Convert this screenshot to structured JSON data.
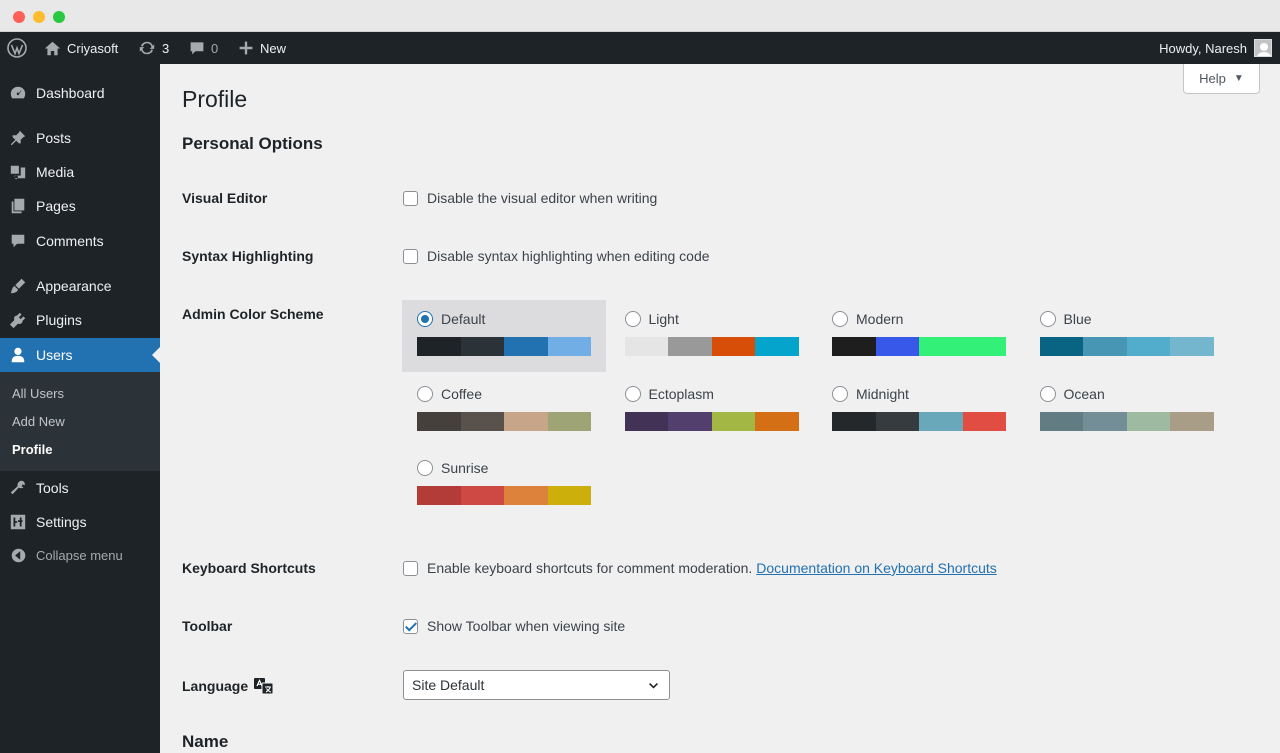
{
  "adminbar": {
    "site_name": "Criyasoft",
    "updates_count": "3",
    "comments_count": "0",
    "new_label": "New",
    "howdy": "Howdy, Naresh"
  },
  "sidebar": {
    "items": [
      {
        "label": "Dashboard",
        "icon": "dashboard-icon"
      },
      {
        "label": "Posts",
        "icon": "pin-icon"
      },
      {
        "label": "Media",
        "icon": "media-icon"
      },
      {
        "label": "Pages",
        "icon": "pages-icon"
      },
      {
        "label": "Comments",
        "icon": "comment-icon"
      },
      {
        "label": "Appearance",
        "icon": "brush-icon"
      },
      {
        "label": "Plugins",
        "icon": "plugin-icon"
      },
      {
        "label": "Users",
        "icon": "user-icon"
      },
      {
        "label": "Tools",
        "icon": "wrench-icon"
      },
      {
        "label": "Settings",
        "icon": "settings-icon"
      }
    ],
    "submenu": [
      "All Users",
      "Add New",
      "Profile"
    ],
    "collapse_label": "Collapse menu"
  },
  "help_label": "Help",
  "page_title": "Profile",
  "personal_options_title": "Personal Options",
  "visual_editor": {
    "label": "Visual Editor",
    "text": "Disable the visual editor when writing",
    "checked": false
  },
  "syntax": {
    "label": "Syntax Highlighting",
    "text": "Disable syntax highlighting when editing code",
    "checked": false
  },
  "color_scheme": {
    "label": "Admin Color Scheme",
    "selected": "Default",
    "schemes": [
      {
        "name": "Default",
        "colors": [
          "#1d2327",
          "#2c3338",
          "#2271b1",
          "#72aee6"
        ]
      },
      {
        "name": "Light",
        "colors": [
          "#e5e5e5",
          "#999999",
          "#d64e07",
          "#04a4cc"
        ]
      },
      {
        "name": "Modern",
        "colors": [
          "#1e1e1e",
          "#3858e9",
          "#33f078",
          "#33f078"
        ]
      },
      {
        "name": "Blue",
        "colors": [
          "#096484",
          "#4796b3",
          "#52accc",
          "#74b6ce"
        ]
      },
      {
        "name": "Coffee",
        "colors": [
          "#46403c",
          "#59524c",
          "#c7a589",
          "#9ea476"
        ]
      },
      {
        "name": "Ectoplasm",
        "colors": [
          "#413256",
          "#523f6d",
          "#a3b745",
          "#d46f15"
        ]
      },
      {
        "name": "Midnight",
        "colors": [
          "#25282b",
          "#363b3f",
          "#69a8bb",
          "#e14d43"
        ]
      },
      {
        "name": "Ocean",
        "colors": [
          "#627c83",
          "#738e96",
          "#9ebaa0",
          "#aa9d88"
        ]
      },
      {
        "name": "Sunrise",
        "colors": [
          "#b43c38",
          "#cf4944",
          "#dd823b",
          "#ccaf0b"
        ]
      }
    ]
  },
  "keyboard": {
    "label": "Keyboard Shortcuts",
    "text": "Enable keyboard shortcuts for comment moderation.",
    "link": "Documentation on Keyboard Shortcuts",
    "checked": false
  },
  "toolbar": {
    "label": "Toolbar",
    "text": "Show Toolbar when viewing site",
    "checked": true
  },
  "language": {
    "label": "Language",
    "value": "Site Default"
  },
  "name_title": "Name"
}
